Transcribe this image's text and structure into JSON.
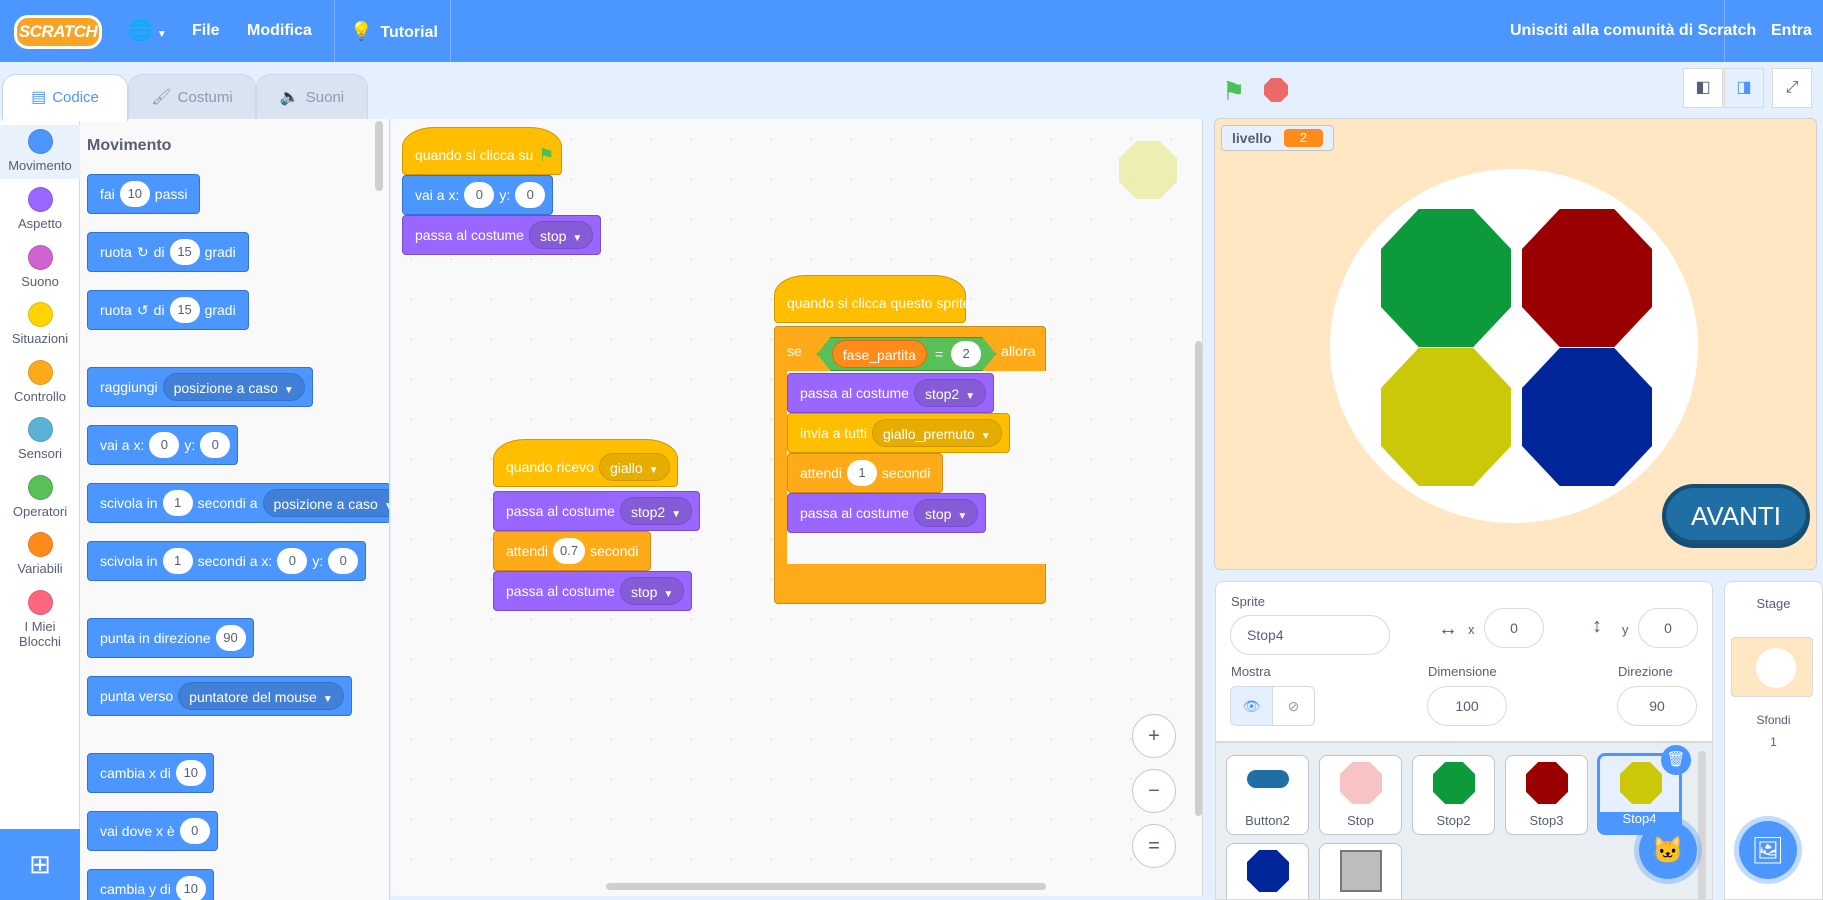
{
  "menubar": {
    "logo": "SCRATCH",
    "globe_icon": "globe-icon",
    "file": "File",
    "edit": "Modifica",
    "tutorials": "Tutorial",
    "join": "Unisciti alla comunità di Scratch",
    "signin": "Entra"
  },
  "tabs": [
    {
      "label": "Codice",
      "icon": "code-icon"
    },
    {
      "label": "Costumi",
      "icon": "brush-icon"
    },
    {
      "label": "Suoni",
      "icon": "speaker-icon"
    }
  ],
  "categories": [
    {
      "label": "Movimento",
      "color": "#4c97ff"
    },
    {
      "label": "Aspetto",
      "color": "#9966ff"
    },
    {
      "label": "Suono",
      "color": "#cf63cf"
    },
    {
      "label": "Situazioni",
      "color": "#ffd500"
    },
    {
      "label": "Controllo",
      "color": "#ffab19"
    },
    {
      "label": "Sensori",
      "color": "#5cb1d6"
    },
    {
      "label": "Operatori",
      "color": "#59c059"
    },
    {
      "label": "Variabili",
      "color": "#ff8c1a"
    },
    {
      "label": "I Miei Blocchi",
      "color": "#ff6680"
    }
  ],
  "palette": {
    "title": "Movimento",
    "move": {
      "a": "fai",
      "n": "10",
      "b": "passi"
    },
    "turn_right": {
      "a": "ruota",
      "b": "di",
      "n": "15",
      "c": "gradi"
    },
    "turn_left": {
      "a": "ruota",
      "b": "di",
      "n": "15",
      "c": "gradi"
    },
    "goto": {
      "a": "raggiungi",
      "dd": "posizione a caso"
    },
    "gotoxy": {
      "a": "vai a x:",
      "x": "0",
      "b": "y:",
      "y": "0"
    },
    "glide": {
      "a": "scivola in",
      "n": "1",
      "b": "secondi a",
      "dd": "posizione a caso"
    },
    "glidexy": {
      "a": "scivola in",
      "n": "1",
      "b": "secondi a x:",
      "x": "0",
      "c": "y:",
      "y": "0"
    },
    "point_dir": {
      "a": "punta in direzione",
      "n": "90"
    },
    "point_towards": {
      "a": "punta verso",
      "dd": "puntatore del mouse"
    },
    "change_x": {
      "a": "cambia x di",
      "n": "10"
    },
    "set_x": {
      "a": "vai dove x è",
      "n": "0"
    },
    "change_y": {
      "a": "cambia y di",
      "n": "10"
    }
  },
  "script1": {
    "hat": "quando si clicca su",
    "gotoxy": {
      "a": "vai a x:",
      "x": "0",
      "b": "y:",
      "y": "0"
    },
    "costume": {
      "a": "passa al costume",
      "dd": "stop"
    }
  },
  "script2": {
    "hat": "quando ricevo",
    "hat_dd": "giallo",
    "costume1": {
      "a": "passa al costume",
      "dd": "stop2"
    },
    "wait": {
      "a": "attendi",
      "n": "0.7",
      "b": "secondi"
    },
    "costume2": {
      "a": "passa al costume",
      "dd": "stop"
    }
  },
  "script3": {
    "hat": "quando si clicca questo sprite",
    "if_a": "se",
    "var": "fase_partita",
    "eq": "=",
    "val": "2",
    "if_b": "allora",
    "costume1": {
      "a": "passa al costume",
      "dd": "stop2"
    },
    "broadcast": {
      "a": "invia a tutti",
      "dd": "giallo_premuto"
    },
    "wait": {
      "a": "attendi",
      "n": "1",
      "b": "secondi"
    },
    "costume2": {
      "a": "passa al costume",
      "dd": "stop"
    }
  },
  "zoom": {
    "in": "+",
    "out": "−",
    "reset": "="
  },
  "stage": {
    "monitor_label": "livello",
    "monitor_value": "2",
    "button": "AVANTI",
    "colors": {
      "green": "#0c9a3b",
      "red": "#9a0000",
      "yellow": "#cbc80a",
      "blue": "#00269a"
    }
  },
  "sprite_info": {
    "sprite_label": "Sprite",
    "sprite_name": "Stop4",
    "x_label": "x",
    "x": "0",
    "y_label": "y",
    "y": "0",
    "show_label": "Mostra",
    "size_label": "Dimensione",
    "size": "100",
    "direction_label": "Direzione",
    "direction": "90"
  },
  "sprites": [
    {
      "name": "Button2"
    },
    {
      "name": "Stop"
    },
    {
      "name": "Stop2"
    },
    {
      "name": "Stop3"
    },
    {
      "name": "Stop4"
    }
  ],
  "stage_pane": {
    "title": "Stage",
    "backdrops_label": "Sfondi",
    "backdrops": "1"
  }
}
